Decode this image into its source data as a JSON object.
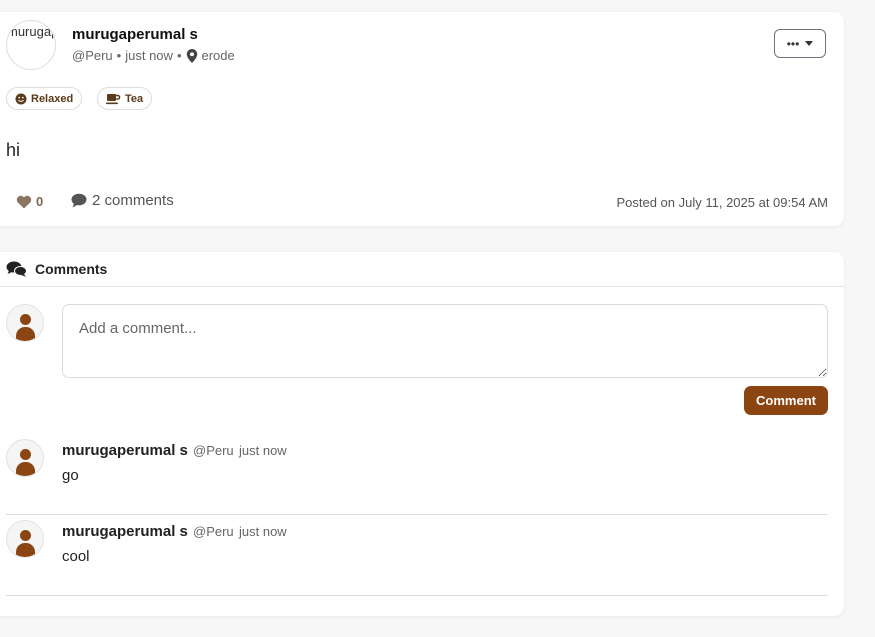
{
  "post": {
    "avatar_alt": "murugaperumal",
    "author_name": "murugaperumal s",
    "handle": "@Peru",
    "separator": "•",
    "time": "just now",
    "location": "erode",
    "menu_label": "•••",
    "tags": [
      {
        "icon": "smile-icon",
        "label": "Relaxed"
      },
      {
        "icon": "coffee-cup-icon",
        "label": "Tea"
      }
    ],
    "body": "hi",
    "likes": "0",
    "comments_label": "2 comments",
    "posted_on": "Posted on July 11, 2025 at 09:54 AM"
  },
  "comments_section": {
    "title": "Comments",
    "input_placeholder": "Add a comment...",
    "submit_label": "Comment",
    "items": [
      {
        "author": "murugaperumal s",
        "handle": "@Peru",
        "time": "just now",
        "text": "go"
      },
      {
        "author": "murugaperumal s",
        "handle": "@Peru",
        "time": "just now",
        "text": "cool"
      }
    ]
  },
  "colors": {
    "accent_brown": "#8b4513",
    "muted_text": "#666666"
  }
}
